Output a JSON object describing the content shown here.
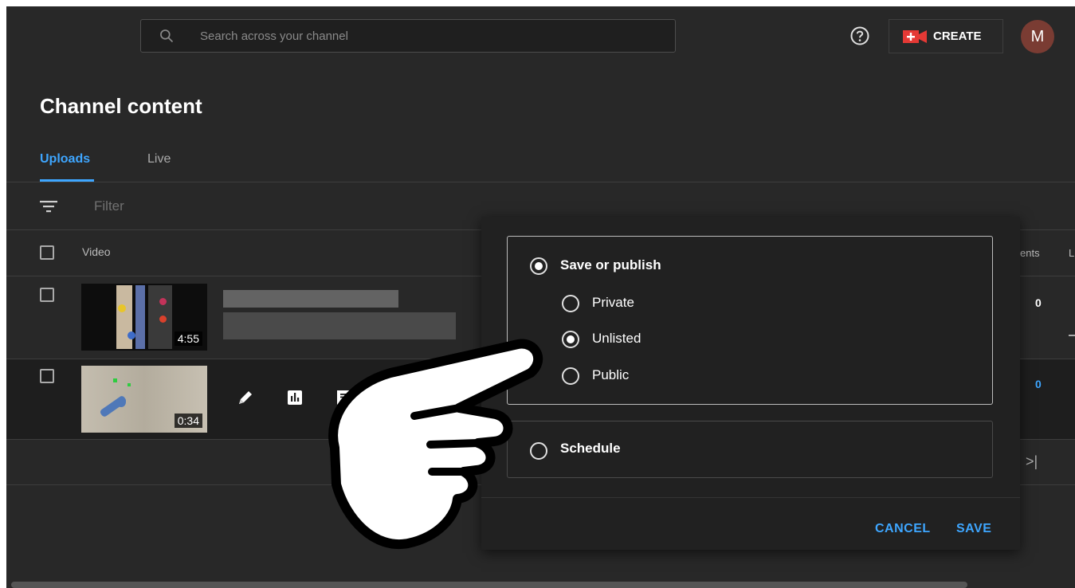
{
  "header": {
    "search_placeholder": "Search across your channel",
    "create_label": "CREATE",
    "avatar_letter": "M",
    "icons": {
      "search": "search-icon",
      "help": "help-icon",
      "create": "video-camera-plus-icon"
    }
  },
  "page": {
    "title": "Channel content",
    "tabs": [
      {
        "label": "Uploads",
        "active": true
      },
      {
        "label": "Live",
        "active": false
      }
    ],
    "filter_placeholder": "Filter"
  },
  "table": {
    "header": {
      "video": "Video",
      "comments_partial": "ents",
      "likes_partial": "L"
    },
    "rows": [
      {
        "duration": "4:55",
        "comments": "0"
      },
      {
        "duration": "0:34",
        "comments": "0"
      }
    ]
  },
  "dialog": {
    "save_or_publish": "Save or publish",
    "options": [
      {
        "label": "Private",
        "selected": false
      },
      {
        "label": "Unlisted",
        "selected": true
      },
      {
        "label": "Public",
        "selected": false
      }
    ],
    "schedule": "Schedule",
    "cancel_label": "CANCEL",
    "save_label": "SAVE"
  },
  "pager": {
    "last_page_glyph": ">|"
  },
  "colors": {
    "background": "#282828",
    "accent": "#3ea6ff",
    "avatar": "#7a3c33",
    "create_icon": "#e53935"
  }
}
